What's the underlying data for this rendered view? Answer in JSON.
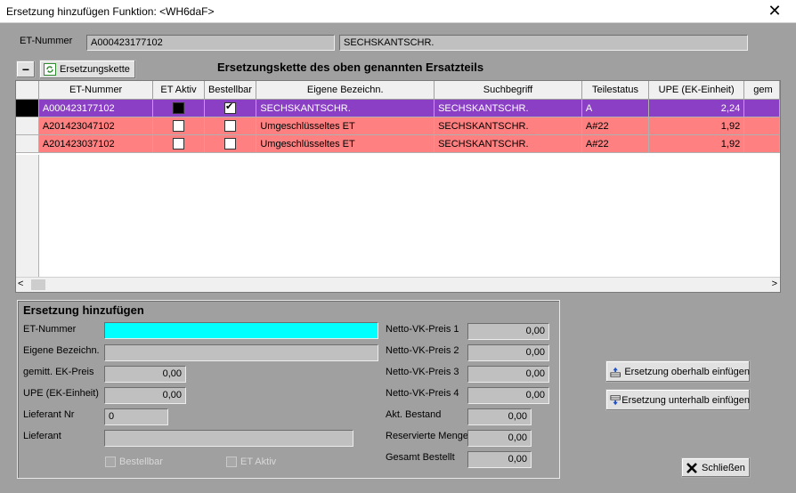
{
  "window": {
    "title": "Ersetzung hinzufügen   Funktion: <WH6daF>",
    "close_symbol": "✕"
  },
  "header": {
    "et_label": "ET-Nummer",
    "et_value": "A000423177102",
    "desc_value": "SECHSKANTSCHR."
  },
  "toolbar": {
    "collapse_symbol": "−",
    "chain_button": "Ersetzungskette",
    "chain_title": "Ersetzungskette des oben genannten Ersatzteils"
  },
  "grid": {
    "columns": [
      "ET-Nummer",
      "ET Aktiv",
      "Bestellbar",
      "Eigene Bezeichn.",
      "Suchbegriff",
      "Teilestatus",
      "UPE (EK-Einheit)",
      "gem"
    ],
    "rows": [
      {
        "et": "A000423177102",
        "aktiv": "black",
        "bestellbar": true,
        "bez": "SECHSKANTSCHR.",
        "such": "SECHSKANTSCHR.",
        "status": "A",
        "upe": "2,24",
        "color": "#8a3fc4"
      },
      {
        "et": "A201423047102",
        "aktiv": "empty",
        "bestellbar": false,
        "bez": "Umgeschlüsseltes ET",
        "such": "SECHSKANTSCHR.",
        "status": "A#22",
        "upe": "1,92",
        "color": "#ff8080"
      },
      {
        "et": "A201423037102",
        "aktiv": "empty",
        "bestellbar": false,
        "bez": "Umgeschlüsseltes ET",
        "such": "SECHSKANTSCHR.",
        "status": "A#22",
        "upe": "1,92",
        "color": "#ff8080"
      }
    ],
    "scroll_left": "<",
    "scroll_right": ">"
  },
  "form": {
    "title": "Ersetzung hinzufügen",
    "et_label": "ET-Nummer",
    "et_value": "",
    "bez_label": "Eigene Bezeichn.",
    "bez_value": "",
    "ek_label": "gemitt. EK-Preis",
    "ek_value": "0,00",
    "upe_label": "UPE (EK-Einheit)",
    "upe_value": "0,00",
    "lief_nr_label": "Lieferant Nr",
    "lief_nr_value": "0",
    "lief_label": "Lieferant",
    "lief_value": "",
    "bestellbar_label": "Bestellbar",
    "aktiv_label": "ET Aktiv",
    "netto1_label": "Netto-VK-Preis 1",
    "netto1_value": "0,00",
    "netto2_label": "Netto-VK-Preis 2",
    "netto2_value": "0,00",
    "netto3_label": "Netto-VK-Preis 3",
    "netto3_value": "0,00",
    "netto4_label": "Netto-VK-Preis 4",
    "netto4_value": "0,00",
    "bestand_label": "Akt. Bestand",
    "bestand_value": "0,00",
    "reserviert_label": "Reservierte Menge",
    "reserviert_value": "0,00",
    "bestellt_label": "Gesamt Bestellt",
    "bestellt_value": "0,00"
  },
  "actions": {
    "insert_above": "Ersetzung oberhalb einfügen",
    "insert_below": "Ersetzung unterhalb einfügen",
    "close": "Schließen"
  },
  "colors": {
    "row_selected": "#8a3fc4",
    "row_replaced": "#ff8080",
    "input_active": "#00ffff"
  }
}
